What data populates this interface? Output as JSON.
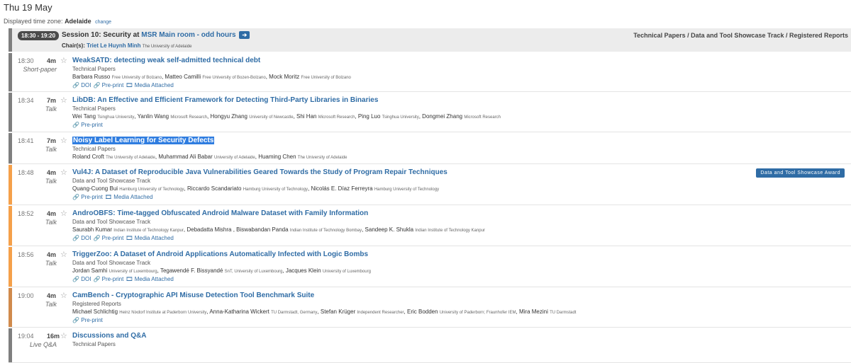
{
  "day": "Thu 19 May",
  "timezone": {
    "label": "Displayed time zone:",
    "value": "Adelaide",
    "change": "change"
  },
  "session": {
    "time": "18:30 - 19:20",
    "title_prefix": "Session 10: Security at",
    "room": "MSR Main room - odd hours",
    "chair_label": "Chair(s):",
    "chair_name": "Triet Le Huynh Minh",
    "chair_aff": "The University of Adelaide",
    "tracks": "Technical Papers / Data and Tool Showcase Track / Registered Reports"
  },
  "colors": {
    "gray": "#7f7f7f",
    "orange": "#f5a04a",
    "brown": "#d08a4c",
    "link": "#2f6ca5"
  },
  "labels": {
    "doi": "DOI",
    "preprint": "Pre-print",
    "media": "Media Attached"
  },
  "talks": [
    {
      "time": "18:30",
      "dur": "4m",
      "type": "Short-paper",
      "title": "WeakSATD: detecting weak self-admitted technical debt",
      "track": "Technical Papers",
      "authors": [
        {
          "name": "Barbara Russo",
          "aff": "Free University of Bolzano"
        },
        {
          "name": "Matteo Camilli",
          "aff": "Free University of Bozen-Bolzano"
        },
        {
          "name": "Mock Moritz",
          "aff": "Free University of Bolzano"
        }
      ]
    },
    {
      "time": "18:34",
      "dur": "7m",
      "type": "Talk",
      "title": "LibDB: An Effective and Efficient Framework for Detecting Third-Party Libraries in Binaries",
      "track": "Technical Papers",
      "authors": [
        {
          "name": "Wei Tang",
          "aff": "Tsinghua University"
        },
        {
          "name": "Yanlin Wang",
          "aff": "Microsoft Research"
        },
        {
          "name": "Hongyu Zhang",
          "aff": "University of Newcastle"
        },
        {
          "name": "Shi Han",
          "aff": "Microsoft Research"
        },
        {
          "name": "Ping Luo",
          "aff": "Tsinghua University"
        },
        {
          "name": "Dongmei Zhang",
          "aff": "Microsoft Research"
        }
      ]
    },
    {
      "time": "18:41",
      "dur": "7m",
      "type": "Talk",
      "title": "Noisy Label Learning for Security Defects",
      "track": "Technical Papers",
      "authors": [
        {
          "name": "Roland Croft",
          "aff": "The University of Adelaide"
        },
        {
          "name": "Muhammad Ali Babar",
          "aff": "University of Adelaide"
        },
        {
          "name": "Huaming Chen",
          "aff": "The University of Adelaide"
        }
      ]
    },
    {
      "time": "18:48",
      "dur": "4m",
      "type": "Talk",
      "title": "Vul4J: A Dataset of Reproducible Java Vulnerabilities Geared Towards the Study of Program Repair Techniques",
      "track": "Data and Tool Showcase Track",
      "award": "Data and Tool Showcase Award",
      "authors": [
        {
          "name": "Quang-Cuong Bui",
          "aff": "Hamburg University of Technology"
        },
        {
          "name": "Riccardo Scandariato",
          "aff": "Hamburg University of Technology"
        },
        {
          "name": "Nicolás E. Díaz Ferreyra",
          "aff": "Hamburg University of Technology"
        }
      ]
    },
    {
      "time": "18:52",
      "dur": "4m",
      "type": "Talk",
      "title": "AndroOBFS: Time-tagged Obfuscated Android Malware Dataset with Family Information",
      "track": "Data and Tool Showcase Track",
      "authors": [
        {
          "name": "Saurabh Kumar",
          "aff": "Indian Institute of Technology Kanpur"
        },
        {
          "name": "Debadatta Mishra",
          "aff": ""
        },
        {
          "name": "Biswabandan Panda",
          "aff": "Indian Institute of Technology Bombay"
        },
        {
          "name": "Sandeep K. Shukla",
          "aff": "Indian Institute of Technology Kanpur"
        }
      ]
    },
    {
      "time": "18:56",
      "dur": "4m",
      "type": "Talk",
      "title": "TriggerZoo: A Dataset of Android Applications Automatically Infected with Logic Bombs",
      "track": "Data and Tool Showcase Track",
      "authors": [
        {
          "name": "Jordan Samhi",
          "aff": "University of Luxembourg"
        },
        {
          "name": "Tegawendé F. Bissyandé",
          "aff": "SnT, University of Luxembourg"
        },
        {
          "name": "Jacques Klein",
          "aff": "University of Luxembourg"
        }
      ]
    },
    {
      "time": "19:00",
      "dur": "4m",
      "type": "Talk",
      "title": "CamBench - Cryptographic API Misuse Detection Tool Benchmark Suite",
      "track": "Registered Reports",
      "authors": [
        {
          "name": "Michael Schlichtig",
          "aff": "Heinz Nixdorf Institute at Paderborn University"
        },
        {
          "name": "Anna-Katharina Wickert",
          "aff": "TU Darmstadt, Germany"
        },
        {
          "name": "Stefan Krüger",
          "aff": "Independent Researcher"
        },
        {
          "name": "Eric Bodden",
          "aff": "University of Paderborn; Fraunhofer IEM"
        },
        {
          "name": "Mira Mezini",
          "aff": "TU Darmstadt"
        }
      ]
    },
    {
      "time": "19:04",
      "dur": "16m",
      "type": "Live Q&A",
      "title": "Discussions and Q&A",
      "track": "Technical Papers",
      "authors": []
    }
  ]
}
